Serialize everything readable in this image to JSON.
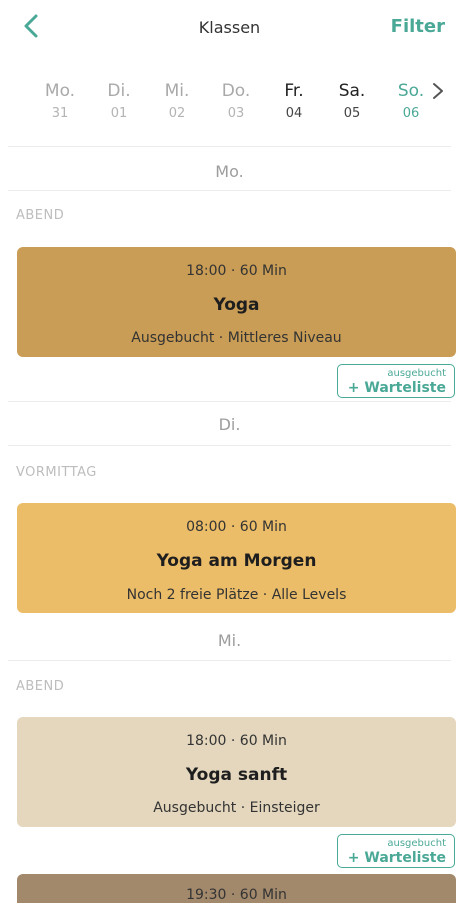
{
  "header": {
    "title": "Klassen",
    "filter_label": "Filter"
  },
  "week": [
    {
      "name": "Mo.",
      "num": "31",
      "state": "past"
    },
    {
      "name": "Di.",
      "num": "01",
      "state": "past"
    },
    {
      "name": "Mi.",
      "num": "02",
      "state": "past"
    },
    {
      "name": "Do.",
      "num": "03",
      "state": "past"
    },
    {
      "name": "Fr.",
      "num": "04",
      "state": "upcoming"
    },
    {
      "name": "Sa.",
      "num": "05",
      "state": "upcoming"
    },
    {
      "name": "So.",
      "num": "06",
      "state": "today"
    }
  ],
  "days": [
    {
      "header": "Mo.",
      "section": "ABEND",
      "class": {
        "time": "18:00 · 60 Min",
        "name": "Yoga",
        "info": "Ausgebucht · Mittleres Niveau",
        "color": "#c99d55"
      },
      "waitlist": {
        "small": "ausgebucht",
        "label": "+ Warteliste"
      }
    },
    {
      "header": "Di.",
      "section": "VORMITTAG",
      "class": {
        "time": "08:00 · 60 Min",
        "name": "Yoga am Morgen",
        "info": "Noch 2 freie Plätze · Alle Levels",
        "color": "#ecbd68"
      }
    },
    {
      "header": "Mi.",
      "section": "ABEND",
      "class": {
        "time": "18:00 · 60 Min",
        "name": "Yoga sanft",
        "info": "Ausgebucht · Einsteiger",
        "color": "#e4d7bd"
      },
      "waitlist": {
        "small": "ausgebucht",
        "label": "+ Warteliste"
      },
      "next_class": {
        "time": "19:30 · 60 Min",
        "color": "#a3896c"
      }
    }
  ],
  "colors": {
    "accent": "#4aa896"
  },
  "icons": {
    "back": "chevron-left-icon",
    "next": "chevron-right-icon"
  }
}
